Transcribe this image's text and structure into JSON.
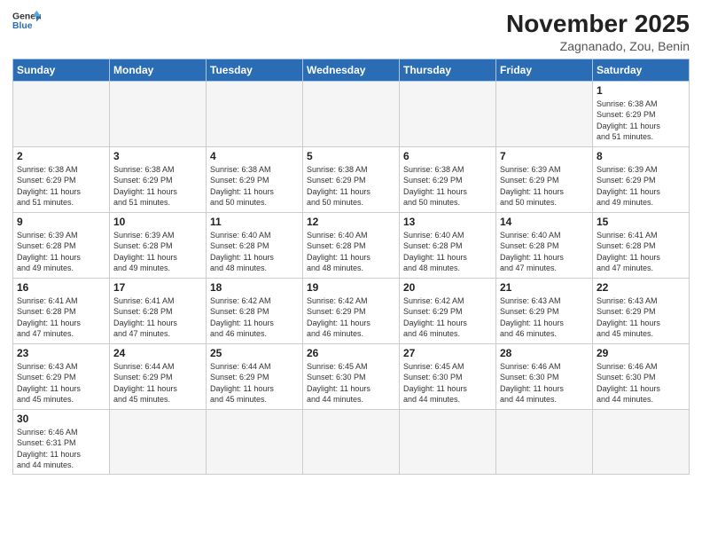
{
  "header": {
    "logo_general": "General",
    "logo_blue": "Blue",
    "month_title": "November 2025",
    "location": "Zagnanado, Zou, Benin"
  },
  "days_of_week": [
    "Sunday",
    "Monday",
    "Tuesday",
    "Wednesday",
    "Thursday",
    "Friday",
    "Saturday"
  ],
  "weeks": [
    [
      {
        "day": "",
        "info": ""
      },
      {
        "day": "",
        "info": ""
      },
      {
        "day": "",
        "info": ""
      },
      {
        "day": "",
        "info": ""
      },
      {
        "day": "",
        "info": ""
      },
      {
        "day": "",
        "info": ""
      },
      {
        "day": "1",
        "info": "Sunrise: 6:38 AM\nSunset: 6:29 PM\nDaylight: 11 hours\nand 51 minutes."
      }
    ],
    [
      {
        "day": "2",
        "info": "Sunrise: 6:38 AM\nSunset: 6:29 PM\nDaylight: 11 hours\nand 51 minutes."
      },
      {
        "day": "3",
        "info": "Sunrise: 6:38 AM\nSunset: 6:29 PM\nDaylight: 11 hours\nand 51 minutes."
      },
      {
        "day": "4",
        "info": "Sunrise: 6:38 AM\nSunset: 6:29 PM\nDaylight: 11 hours\nand 50 minutes."
      },
      {
        "day": "5",
        "info": "Sunrise: 6:38 AM\nSunset: 6:29 PM\nDaylight: 11 hours\nand 50 minutes."
      },
      {
        "day": "6",
        "info": "Sunrise: 6:38 AM\nSunset: 6:29 PM\nDaylight: 11 hours\nand 50 minutes."
      },
      {
        "day": "7",
        "info": "Sunrise: 6:39 AM\nSunset: 6:29 PM\nDaylight: 11 hours\nand 50 minutes."
      },
      {
        "day": "8",
        "info": "Sunrise: 6:39 AM\nSunset: 6:29 PM\nDaylight: 11 hours\nand 49 minutes."
      }
    ],
    [
      {
        "day": "9",
        "info": "Sunrise: 6:39 AM\nSunset: 6:28 PM\nDaylight: 11 hours\nand 49 minutes."
      },
      {
        "day": "10",
        "info": "Sunrise: 6:39 AM\nSunset: 6:28 PM\nDaylight: 11 hours\nand 49 minutes."
      },
      {
        "day": "11",
        "info": "Sunrise: 6:40 AM\nSunset: 6:28 PM\nDaylight: 11 hours\nand 48 minutes."
      },
      {
        "day": "12",
        "info": "Sunrise: 6:40 AM\nSunset: 6:28 PM\nDaylight: 11 hours\nand 48 minutes."
      },
      {
        "day": "13",
        "info": "Sunrise: 6:40 AM\nSunset: 6:28 PM\nDaylight: 11 hours\nand 48 minutes."
      },
      {
        "day": "14",
        "info": "Sunrise: 6:40 AM\nSunset: 6:28 PM\nDaylight: 11 hours\nand 47 minutes."
      },
      {
        "day": "15",
        "info": "Sunrise: 6:41 AM\nSunset: 6:28 PM\nDaylight: 11 hours\nand 47 minutes."
      }
    ],
    [
      {
        "day": "16",
        "info": "Sunrise: 6:41 AM\nSunset: 6:28 PM\nDaylight: 11 hours\nand 47 minutes."
      },
      {
        "day": "17",
        "info": "Sunrise: 6:41 AM\nSunset: 6:28 PM\nDaylight: 11 hours\nand 47 minutes."
      },
      {
        "day": "18",
        "info": "Sunrise: 6:42 AM\nSunset: 6:28 PM\nDaylight: 11 hours\nand 46 minutes."
      },
      {
        "day": "19",
        "info": "Sunrise: 6:42 AM\nSunset: 6:29 PM\nDaylight: 11 hours\nand 46 minutes."
      },
      {
        "day": "20",
        "info": "Sunrise: 6:42 AM\nSunset: 6:29 PM\nDaylight: 11 hours\nand 46 minutes."
      },
      {
        "day": "21",
        "info": "Sunrise: 6:43 AM\nSunset: 6:29 PM\nDaylight: 11 hours\nand 46 minutes."
      },
      {
        "day": "22",
        "info": "Sunrise: 6:43 AM\nSunset: 6:29 PM\nDaylight: 11 hours\nand 45 minutes."
      }
    ],
    [
      {
        "day": "23",
        "info": "Sunrise: 6:43 AM\nSunset: 6:29 PM\nDaylight: 11 hours\nand 45 minutes."
      },
      {
        "day": "24",
        "info": "Sunrise: 6:44 AM\nSunset: 6:29 PM\nDaylight: 11 hours\nand 45 minutes."
      },
      {
        "day": "25",
        "info": "Sunrise: 6:44 AM\nSunset: 6:29 PM\nDaylight: 11 hours\nand 45 minutes."
      },
      {
        "day": "26",
        "info": "Sunrise: 6:45 AM\nSunset: 6:30 PM\nDaylight: 11 hours\nand 44 minutes."
      },
      {
        "day": "27",
        "info": "Sunrise: 6:45 AM\nSunset: 6:30 PM\nDaylight: 11 hours\nand 44 minutes."
      },
      {
        "day": "28",
        "info": "Sunrise: 6:46 AM\nSunset: 6:30 PM\nDaylight: 11 hours\nand 44 minutes."
      },
      {
        "day": "29",
        "info": "Sunrise: 6:46 AM\nSunset: 6:30 PM\nDaylight: 11 hours\nand 44 minutes."
      }
    ],
    [
      {
        "day": "30",
        "info": "Sunrise: 6:46 AM\nSunset: 6:31 PM\nDaylight: 11 hours\nand 44 minutes."
      },
      {
        "day": "",
        "info": ""
      },
      {
        "day": "",
        "info": ""
      },
      {
        "day": "",
        "info": ""
      },
      {
        "day": "",
        "info": ""
      },
      {
        "day": "",
        "info": ""
      },
      {
        "day": "",
        "info": ""
      }
    ]
  ]
}
